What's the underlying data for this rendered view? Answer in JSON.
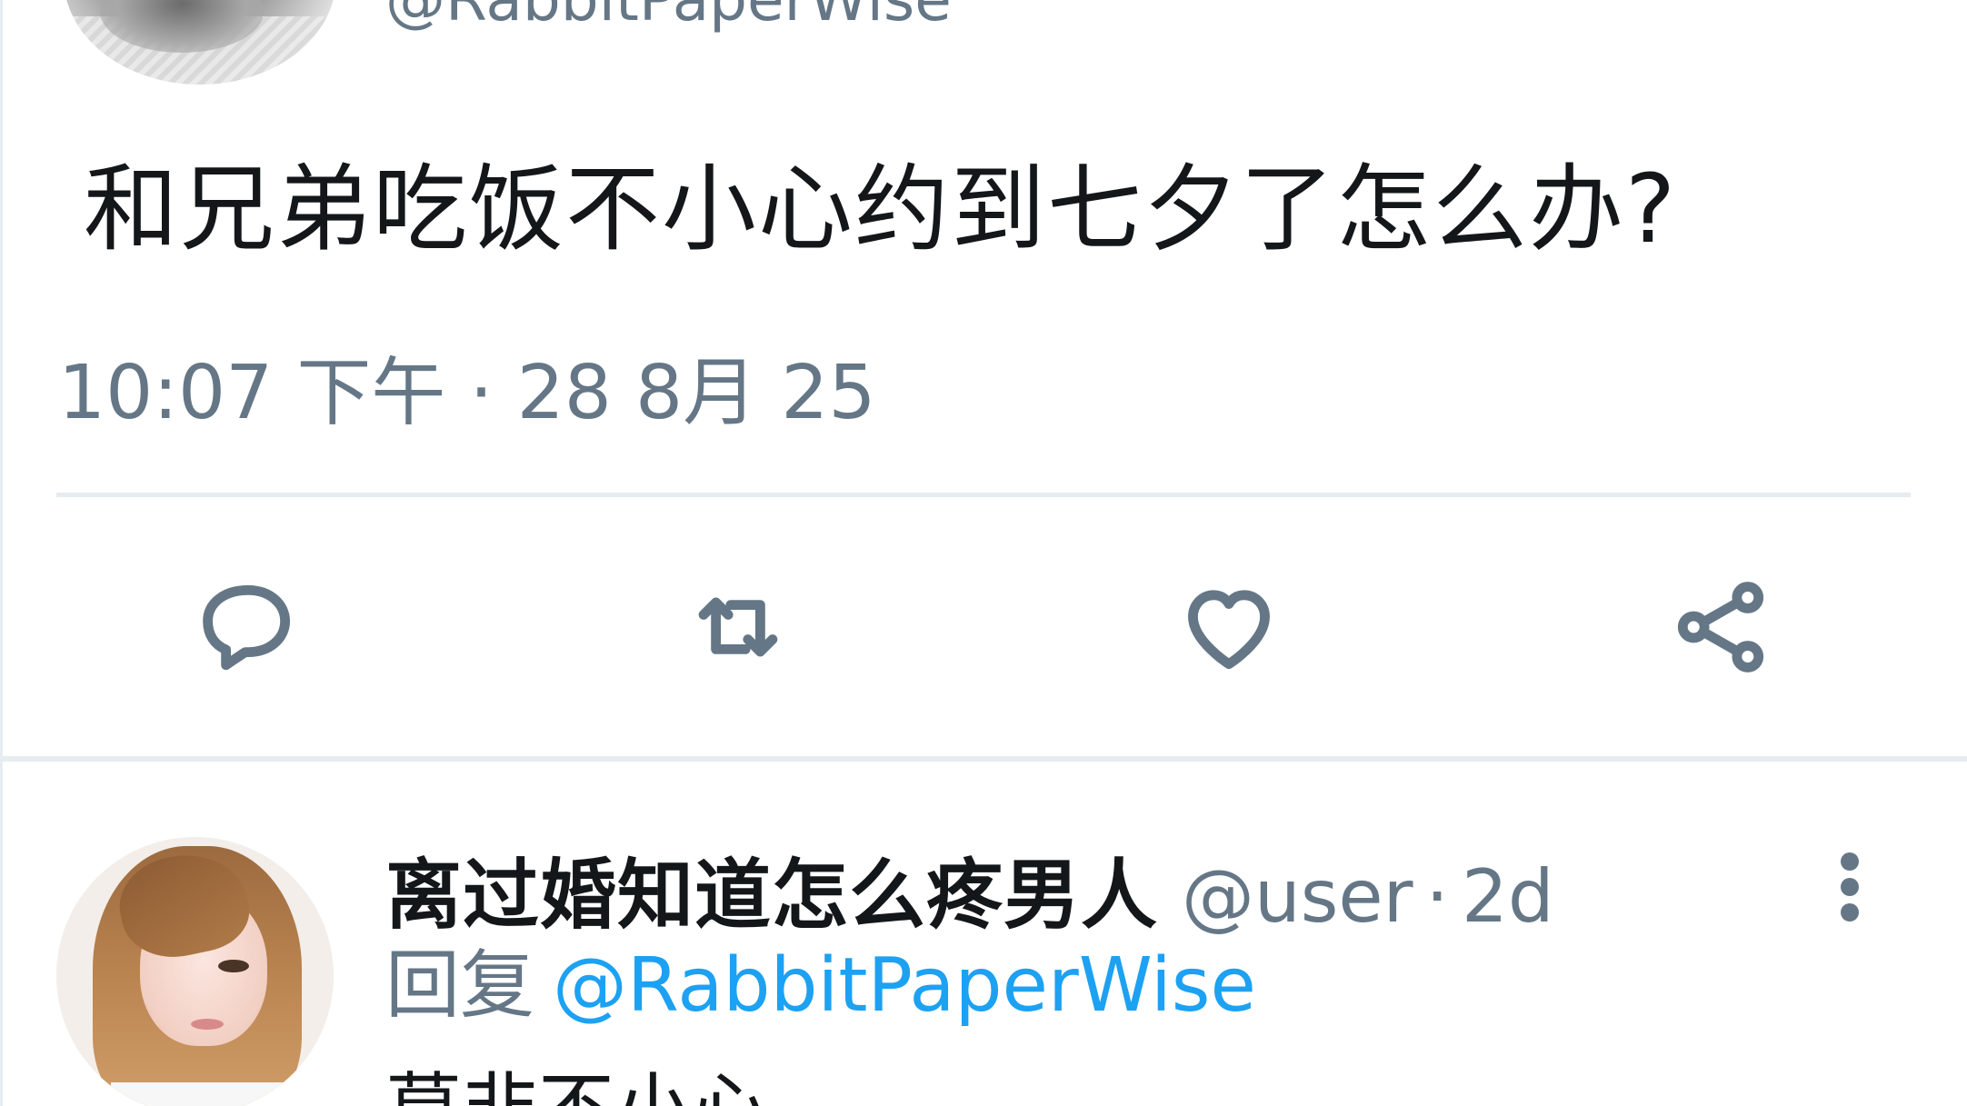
{
  "main_tweet": {
    "handle": "@RabbitPaperWise",
    "text": "和兄弟吃饭不小心约到七夕了怎么办?",
    "timestamp": "10:07 下午 · 28 8月 25"
  },
  "actions": [
    {
      "name": "reply",
      "icon": "comment-icon"
    },
    {
      "name": "retweet",
      "icon": "retweet-icon"
    },
    {
      "name": "like",
      "icon": "heart-icon"
    },
    {
      "name": "share",
      "icon": "share-icon"
    }
  ],
  "reply_tweet": {
    "display_name": "离过婚知道怎么疼男人",
    "handle": "@user",
    "separator": "·",
    "age": "2d",
    "reply_prefix": "回复",
    "reply_to": "@RabbitPaperWise",
    "text_partial": "莫非不小心"
  },
  "colors": {
    "text_primary": "#14171a",
    "text_secondary": "#657786",
    "link": "#1da1f2",
    "divider": "#e6ecf0"
  }
}
